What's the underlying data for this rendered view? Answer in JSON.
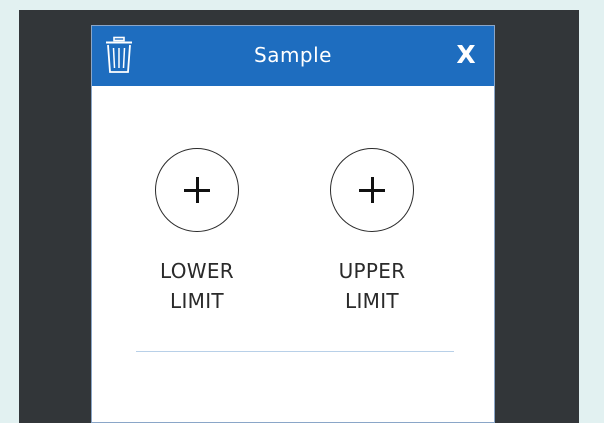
{
  "dialog": {
    "title": "Sample",
    "close_label": "X",
    "delete_icon": "trash-icon"
  },
  "limits": {
    "lower": {
      "icon": "plus-icon",
      "label_line1": "LOWER",
      "label_line2": "LIMIT"
    },
    "upper": {
      "icon": "plus-icon",
      "label_line1": "UPPER",
      "label_line2": "LIMIT"
    }
  },
  "colors": {
    "header": "#1e6dbf",
    "backdrop": "#323639",
    "page": "#e2f1f1"
  }
}
